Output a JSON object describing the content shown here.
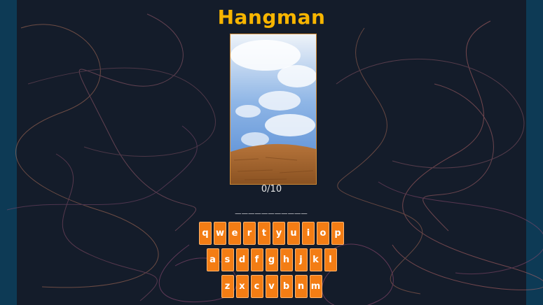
{
  "app": {
    "title": "Hangman"
  },
  "game": {
    "progress": "0/10",
    "word_mask": "___________"
  },
  "keyboard": {
    "rows": [
      [
        "q",
        "w",
        "e",
        "r",
        "t",
        "y",
        "u",
        "i",
        "o",
        "p"
      ],
      [
        "a",
        "s",
        "d",
        "f",
        "g",
        "h",
        "j",
        "k",
        "l"
      ],
      [
        "z",
        "x",
        "c",
        "v",
        "b",
        "n",
        "m"
      ]
    ]
  },
  "colors": {
    "title": "#f7b500",
    "key_bg": "#f37d14",
    "stage_bg": "#141c2a",
    "frame_bg": "#0d3a55"
  },
  "icons": {
    "scene": "sky-and-ground-illustration",
    "background": "scribble-lines"
  }
}
